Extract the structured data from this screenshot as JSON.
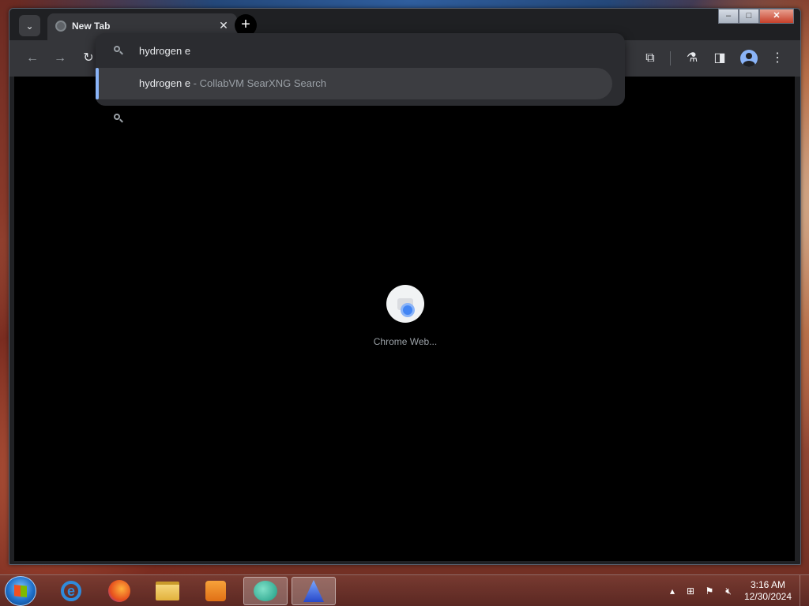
{
  "browser": {
    "tab": {
      "title": "New Tab"
    },
    "omnibox": {
      "value": "hydrogen e",
      "suggestion": {
        "query": "hydrogen e",
        "separator": " - ",
        "source": "CollabVM SearXNG Search"
      }
    },
    "shortcut": {
      "label": "Chrome Web..."
    }
  },
  "window_controls": {
    "minimize": "–",
    "maximize": "□",
    "close": "✕"
  },
  "taskbar": {
    "items": [
      {
        "name": "internet-explorer",
        "icon": "ie-icon"
      },
      {
        "name": "firefox",
        "icon": "firefox-icon"
      },
      {
        "name": "file-explorer",
        "icon": "folder-icon"
      },
      {
        "name": "media-player",
        "icon": "media-player-icon"
      },
      {
        "name": "chat-app",
        "icon": "chat-bubble-icon",
        "active": true
      },
      {
        "name": "blue-app",
        "icon": "blue-app-icon"
      }
    ],
    "clock": {
      "time": "3:16 AM",
      "date": "12/30/2024"
    }
  },
  "colors": {
    "accent": "#8ab4f8",
    "toolbar": "#35363a",
    "content": "#000000"
  }
}
